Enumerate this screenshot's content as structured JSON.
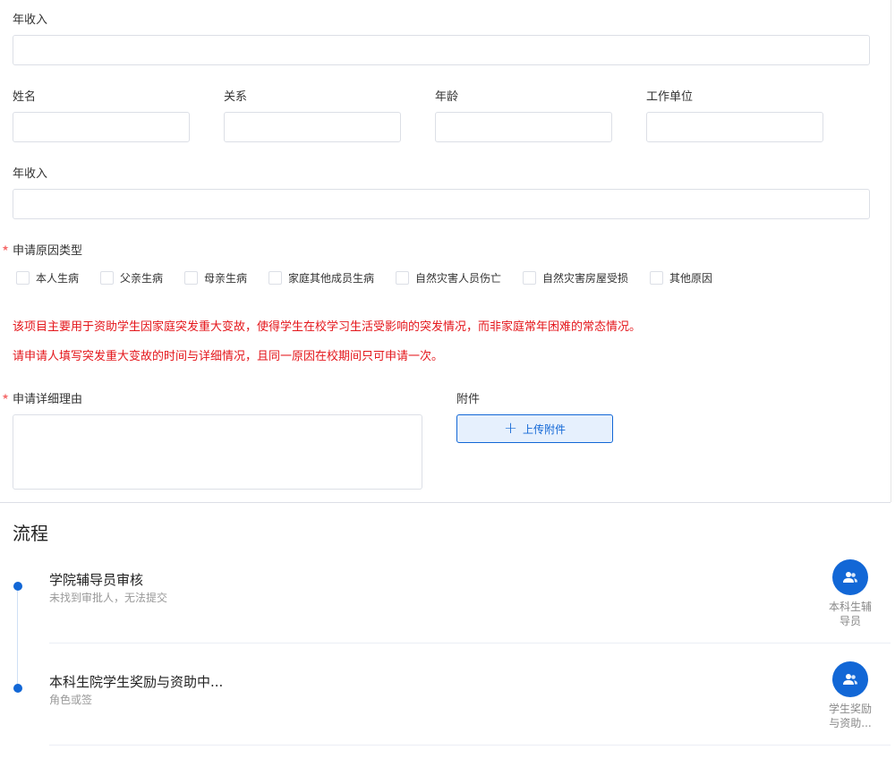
{
  "form": {
    "annual_income_label_1": "年收入",
    "member": {
      "name_label": "姓名",
      "relation_label": "关系",
      "age_label": "年龄",
      "work_unit_label": "工作单位"
    },
    "annual_income_label_2": "年收入",
    "reason_type": {
      "required_mark": "★",
      "label": "申请原因类型",
      "options": [
        "本人生病",
        "父亲生病",
        "母亲生病",
        "家庭其他成员生病",
        "自然灾害人员伤亡",
        "自然灾害房屋受损",
        "其他原因"
      ]
    },
    "notes": [
      "该项目主要用于资助学生因家庭突发重大变故，使得学生在校学习生活受影响的突发情况，而非家庭常年困难的常态情况。",
      "请申请人填写突发重大变故的时间与详细情况，且同一原因在校期间只可申请一次。"
    ],
    "detail_reason": {
      "required_mark": "★",
      "label": "申请详细理由"
    },
    "attachment": {
      "label": "附件",
      "upload_plus": "+",
      "upload_label": "上传附件"
    }
  },
  "flow": {
    "title": "流程",
    "steps": [
      {
        "title": "学院辅导员审核",
        "subtitle": "未找到审批人，无法提交",
        "approver_line1": "本科生辅",
        "approver_line2": "导员"
      },
      {
        "title": "本科生院学生奖励与资助中...",
        "subtitle": "角色或签",
        "approver_line1": "学生奖励",
        "approver_line2": "与资助..."
      }
    ]
  },
  "colors": {
    "accent": "#1267d6",
    "warning_text": "#e4161b",
    "required_star": "#f56c6c",
    "border": "#dcdfe6"
  },
  "icons": {
    "upload": "plus-icon",
    "approver": "user-group-icon"
  }
}
